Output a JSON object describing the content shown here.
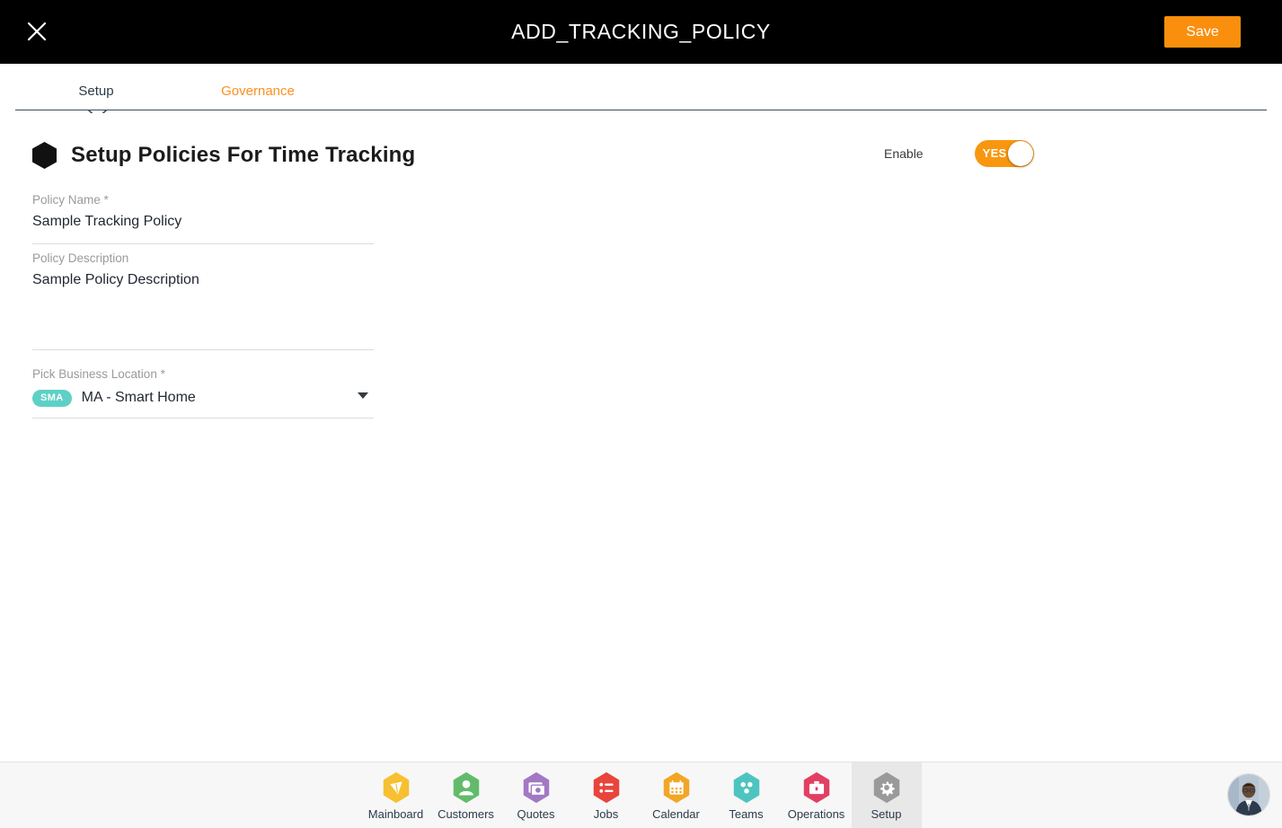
{
  "header": {
    "title": "ADD_TRACKING_POLICY",
    "close_icon": "close-icon",
    "save_label": "Save"
  },
  "tabs": [
    {
      "label": "Setup",
      "active": true
    },
    {
      "label": "Governance",
      "active": false
    }
  ],
  "section": {
    "icon": "hexagon-icon",
    "title": "Setup Policies For Time Tracking"
  },
  "enable": {
    "label": "Enable",
    "toggle_value": "YES",
    "toggle_on": true
  },
  "fields": {
    "policy_name": {
      "label": "Policy Name *",
      "value": "Sample Tracking Policy",
      "placeholder": "Policy Name"
    },
    "policy_description": {
      "label": "Policy Description",
      "value": "Sample Policy Description",
      "placeholder": "Policy Description"
    },
    "business_location": {
      "label": "Pick Business Location *",
      "chip": "SMA",
      "value": "MA - Smart Home",
      "caret_icon": "chevron-down-icon"
    }
  },
  "bottom_nav": {
    "items": [
      {
        "label": "Mainboard",
        "icon": "mainboard-icon",
        "color": "#f6c031",
        "active": false
      },
      {
        "label": "Customers",
        "icon": "customers-icon",
        "color": "#62bb6a",
        "active": false
      },
      {
        "label": "Quotes",
        "icon": "quotes-icon",
        "color": "#a278c4",
        "active": false
      },
      {
        "label": "Jobs",
        "icon": "jobs-icon",
        "color": "#e8453c",
        "active": false
      },
      {
        "label": "Calendar",
        "icon": "calendar-icon",
        "color": "#f2a626",
        "active": false
      },
      {
        "label": "Teams",
        "icon": "teams-icon",
        "color": "#4ec4c0",
        "active": false
      },
      {
        "label": "Operations",
        "icon": "operations-icon",
        "color": "#e23f63",
        "active": false
      },
      {
        "label": "Setup",
        "icon": "setup-icon",
        "color": "#9a9a9a",
        "active": true
      }
    ],
    "avatar": "user-avatar"
  },
  "colors": {
    "accent_orange": "#f98f0c",
    "header_black": "#000000",
    "chip_teal": "#5ed0c5",
    "tab_inactive": "#ff8f1f",
    "tab_active": "#2b3a4a"
  }
}
